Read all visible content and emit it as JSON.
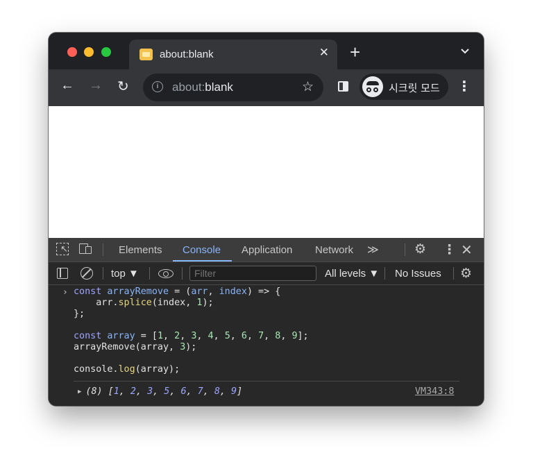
{
  "browser": {
    "tab": {
      "title": "about:blank",
      "close": "✕",
      "favicon": "page-icon"
    },
    "new_tab": "+",
    "tab_search": "chevron-down-icon",
    "toolbar": {
      "back": "←",
      "forward": "→",
      "reload": "↻",
      "url_scheme": "about:",
      "url_host": "blank",
      "bookmark": "☆",
      "incognito_label": "시크릿 모드",
      "menu": "⋮"
    }
  },
  "devtools": {
    "tabs": [
      {
        "label": "Elements"
      },
      {
        "label": "Console",
        "active": true
      },
      {
        "label": "Application"
      },
      {
        "label": "Network"
      }
    ],
    "more_tabs": "≫",
    "kebab": "⋮",
    "close": "✕",
    "gear": "⚙",
    "console": {
      "context": "top ▼",
      "filter_placeholder": "Filter",
      "levels": "All levels ▼",
      "issues": "No Issues",
      "prompt": "›",
      "code_lines": [
        "const arrayRemove = (arr, index) => {",
        "    arr.splice(index, 1);",
        "};",
        "",
        "const array = [1, 2, 3, 4, 5, 6, 7, 8, 9];",
        "arrayRemove(array, 3);",
        "",
        "console.log(array);"
      ],
      "output": {
        "text": "(8) [1, 2, 3, 5, 6, 7, 8, 9]",
        "count": "(8)",
        "values": [
          1,
          2,
          3,
          5,
          6,
          7,
          8,
          9
        ],
        "source": "VM343:8"
      }
    }
  },
  "colors": {
    "accent": "#8ab4f8",
    "keyword": "#9da5ff",
    "function": "#e6d683",
    "number": "#a8e6b4"
  }
}
